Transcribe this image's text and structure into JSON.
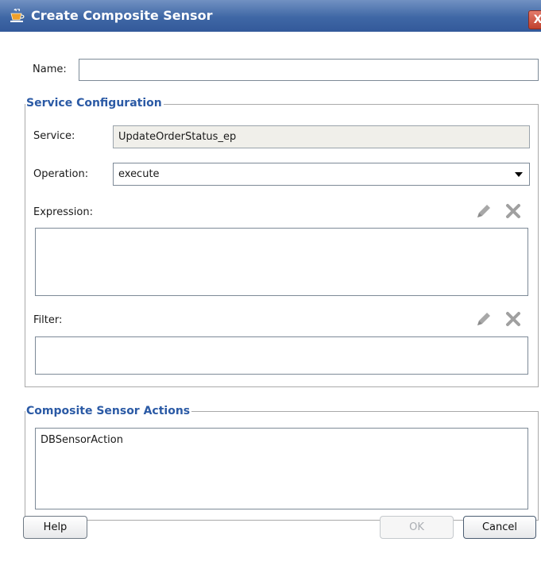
{
  "window": {
    "title": "Create Composite Sensor",
    "close_glyph": "X"
  },
  "name": {
    "label": "Name:",
    "value": ""
  },
  "service_configuration": {
    "legend": "Service Configuration",
    "service": {
      "label": "Service:",
      "value": "UpdateOrderStatus_ep"
    },
    "operation": {
      "label": "Operation:",
      "value": "execute"
    },
    "expression": {
      "label": "Expression:",
      "value": ""
    },
    "filter": {
      "label": "Filter:",
      "value": ""
    }
  },
  "composite_sensor_actions": {
    "legend": "Composite Sensor Actions",
    "items": [
      "DBSensorAction"
    ]
  },
  "buttons": {
    "help": "Help",
    "ok": "OK",
    "cancel": "Cancel"
  },
  "colors": {
    "titlebar": "#3f67a5",
    "legend_text": "#2b5aa5",
    "readonly_bg": "#f0efea"
  },
  "icons": [
    "coffee-cup-icon",
    "close-icon",
    "pencil-icon",
    "delete-x-icon",
    "chevron-down-icon"
  ]
}
